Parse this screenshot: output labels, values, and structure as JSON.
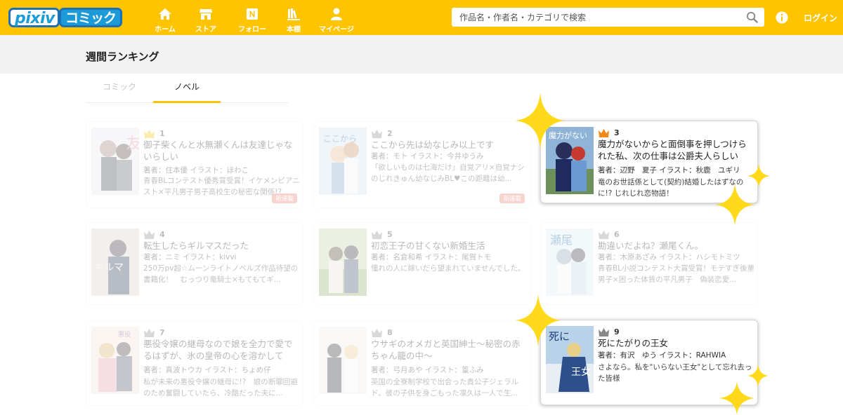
{
  "colors": {
    "accent": "#ffc400",
    "crown_gold": "#f5c400",
    "crown_gray": "#888888",
    "crown_orange": "#f08a1a",
    "badge": "#e87c6b"
  },
  "header": {
    "logo_pixiv": "pixiv",
    "logo_comic": "コミック",
    "nav": [
      {
        "label": "ホーム",
        "icon": "home-icon"
      },
      {
        "label": "ストア",
        "icon": "store-icon"
      },
      {
        "label": "フォロー",
        "icon": "follow-n-icon"
      },
      {
        "label": "本棚",
        "icon": "bookshelf-icon"
      },
      {
        "label": "マイページ",
        "icon": "user-icon"
      }
    ],
    "search_placeholder": "作品名・作者名・カテゴリで検索",
    "login": "ログイン"
  },
  "page_title": "週間ランキング",
  "tabs": [
    {
      "label": "コミック",
      "active": false
    },
    {
      "label": "ノベル",
      "active": true
    }
  ],
  "ranking": [
    {
      "rank": "1",
      "title": "御子柴くんと水無瀬くんは友達じゃないらしい",
      "author": "著者：住本優 イラスト：ほわこ",
      "desc": "青春BLコンテスト優秀賞受賞！イケメンピアニスト×平凡男子男子高校生の秘密な関係!?",
      "badge": "新連載",
      "highlight": false
    },
    {
      "rank": "2",
      "title": "ここから先は幼なじみ以上です",
      "author": "著者：モト イラスト：今井ゆうみ",
      "desc": "「欲しいものは七海だけ」自覚アリ×自覚ナシのじれきゅん幼なじみBL♥この距離は幼...",
      "badge": "新連載",
      "highlight": false
    },
    {
      "rank": "3",
      "title": "魔力がないからと面倒事を押しつけられた私、次の仕事は公爵夫人らしいで...",
      "author": "著者：辺野　夏子 イラスト：秋鹿　ユギリ",
      "desc": "竜のお世話係として(契約)結婚したはずなのに!? じれじれ恋物語！",
      "badge": "",
      "highlight": true
    },
    {
      "rank": "4",
      "title": "転生したらギルマスだった",
      "author": "著者：ニミ イラスト：kivvi",
      "desc": "250万pv超☆ムーンライトノベルズ作品待望の書籍化！　むっつり竜騎士×もてもてギ...",
      "badge": "",
      "highlight": false
    },
    {
      "rank": "5",
      "title": "初恋王子の甘くない新婚生活",
      "author": "著者：名倉和希 イラスト：尾賀トモ",
      "desc": "憧れの人に嫁いだら望まれていませんでした。",
      "badge": "",
      "highlight": false
    },
    {
      "rank": "6",
      "title": "勘違いだよね？瀬尾くん。",
      "author": "著者：木原あざみ イラスト：ハシモトミツ",
      "desc": "青春BL小説コンテスト大賞受賞！モテすぎ後輩男子×困った体質の平凡男子　偽装恋愛...",
      "badge": "",
      "highlight": false
    },
    {
      "rank": "7",
      "title": "悪役令嬢の継母なので娘を全力で愛でるはずが、氷の皇帝の心を溶かしてし...",
      "author": "著者：真波トウカ イラスト：ちょめ仔",
      "desc": "私が未来の悪役令嬢の継母に!?　娘の断罪回避のため奮闘していたら、冷酷だった夫に...",
      "badge": "",
      "highlight": false
    },
    {
      "rank": "8",
      "title": "ウサギのオメガと英国紳士～秘密の赤ちゃん籠の中～",
      "author": "著者：弓月あや イラスト：篁ふみ",
      "desc": "英国の全寮制学校で出会った貴公子ジェラルド。彼の子供を身ごもった凛久は一人で生...",
      "badge": "",
      "highlight": false
    },
    {
      "rank": "9",
      "title": "死にたがりの王女",
      "author": "著者：有沢　ゆう イラスト：RAHWIA",
      "desc": "さよなら。私を\"いらない王女\"として忘れ去った皆様",
      "badge": "",
      "highlight": true
    }
  ]
}
